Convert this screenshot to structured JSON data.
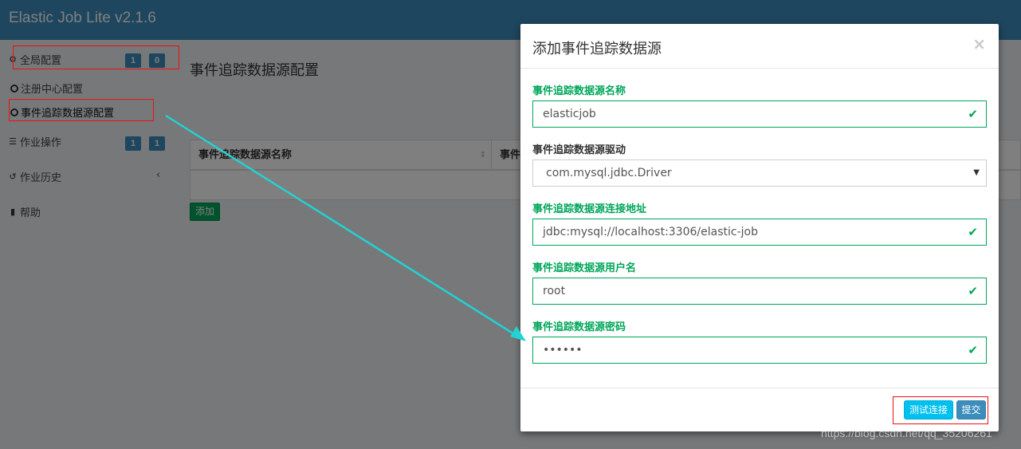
{
  "app": {
    "title": "Elastic Job Lite v2.1.6"
  },
  "sidebar": {
    "global_config": {
      "label": "全局配置",
      "badges": [
        "1",
        "0"
      ]
    },
    "registry_config": {
      "label": "注册中心配置"
    },
    "event_trace_config": {
      "label": "事件追踪数据源配置"
    },
    "job_operation": {
      "label": "作业操作",
      "badges": [
        "1",
        "1"
      ]
    },
    "job_history": {
      "label": "作业历史"
    },
    "help": {
      "label": "帮助"
    }
  },
  "main": {
    "page_title": "事件追踪数据源配置",
    "table_headers": [
      "事件追踪数据源名称",
      "事件"
    ],
    "add_button": "添加"
  },
  "modal": {
    "title": "添加事件追踪数据源",
    "close": "×",
    "fields": [
      {
        "label": "事件追踪数据源名称",
        "value": "elasticjob",
        "valid": true
      },
      {
        "label": "事件追踪数据源驱动",
        "value": "com.mysql.jdbc.Driver",
        "valid": false
      },
      {
        "label": "事件追踪数据源连接地址",
        "value": "jdbc:mysql://localhost:3306/elastic-job",
        "valid": true
      },
      {
        "label": "事件追踪数据源用户名",
        "value": "root",
        "valid": true
      },
      {
        "label": "事件追踪数据源密码",
        "value": "••••••",
        "valid": true
      }
    ],
    "test_button": "测试连接",
    "submit_button": "提交"
  },
  "watermark": "https://blog.csdn.net/qq_35206261",
  "colors": {
    "primary": "#3c8dbc",
    "success": "#00a65a",
    "info": "#00c0ef",
    "annotation_red": "#ee1111",
    "annotation_arrow": "#22d3d3"
  }
}
